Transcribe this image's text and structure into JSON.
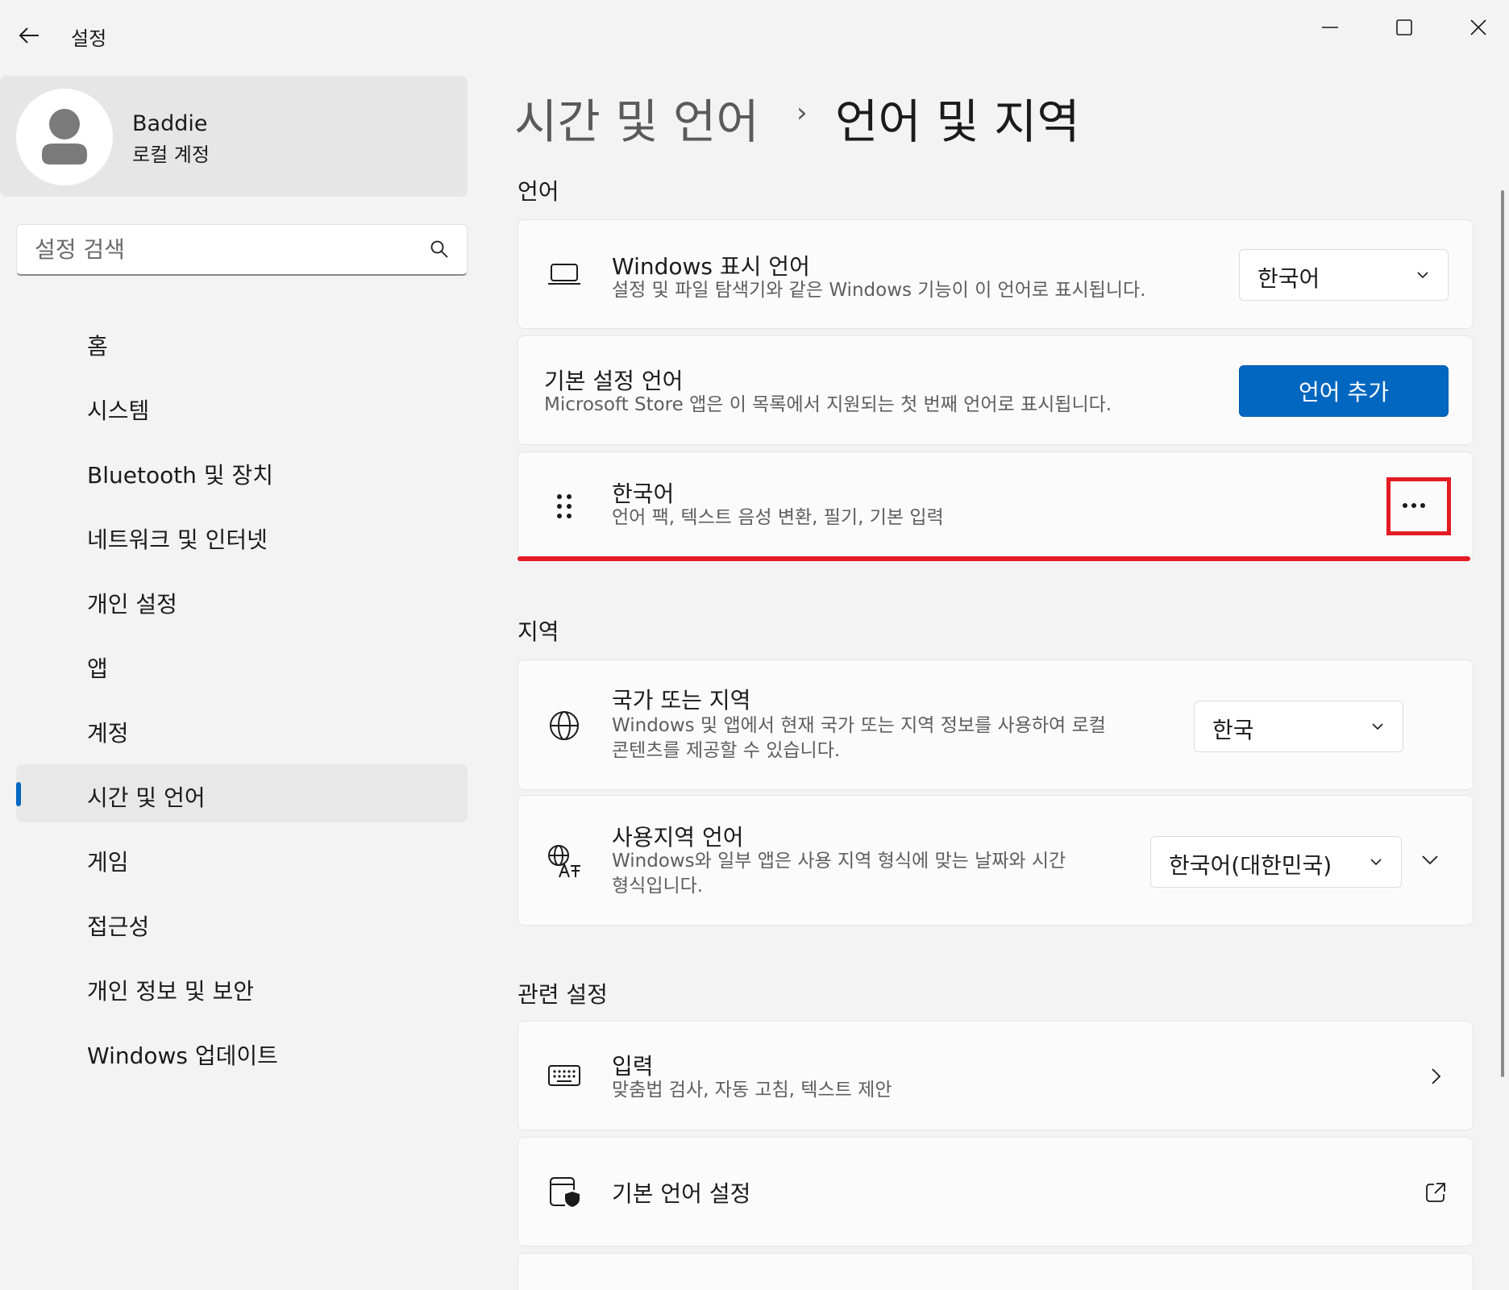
{
  "app": {
    "title": "설정"
  },
  "profile": {
    "name": "Baddie",
    "account_type": "로컬 계정"
  },
  "search": {
    "placeholder": "설정 검색"
  },
  "nav": {
    "items": [
      {
        "label": "홈"
      },
      {
        "label": "시스템"
      },
      {
        "label": "Bluetooth 및 장치"
      },
      {
        "label": "네트워크 및 인터넷"
      },
      {
        "label": "개인 설정"
      },
      {
        "label": "앱"
      },
      {
        "label": "계정"
      },
      {
        "label": "시간 및 언어",
        "selected": true
      },
      {
        "label": "게임"
      },
      {
        "label": "접근성"
      },
      {
        "label": "개인 정보 및 보안"
      },
      {
        "label": "Windows 업데이트"
      }
    ]
  },
  "breadcrumb": {
    "parent": "시간 및 언어",
    "separator": "›",
    "current": "언어 및 지역"
  },
  "language_section": {
    "header": "언어",
    "display_language": {
      "icon": "laptop-icon",
      "title": "Windows 표시 언어",
      "description": "설정 및 파일 탐색기와 같은 Windows 기능이 이 언어로 표시됩니다.",
      "value": "한국어"
    },
    "preferred_languages": {
      "title": "기본 설정 언어",
      "description": "Microsoft Store 앱은 이 목록에서 지원되는 첫 번째 언어로 표시됩니다.",
      "add_button": "언어 추가"
    },
    "installed_language": {
      "icon": "drag-handle-icon",
      "title": "한국어",
      "description": "언어 팩, 텍스트 음성 변환, 필기, 기본 입력",
      "more_icon": "more-options-icon"
    }
  },
  "region_section": {
    "header": "지역",
    "country": {
      "icon": "globe-icon",
      "title": "국가 또는 지역",
      "description_line1": "Windows 및 앱에서 현재 국가 또는 지역 정보를 사용하여 로컬",
      "description_line2": "콘텐츠를 제공할 수 있습니다.",
      "value": "한국"
    },
    "regional_format": {
      "icon": "regional-format-icon",
      "title": "사용지역 언어",
      "description_line1": "Windows와 일부 앱은 사용 지역 형식에 맞는 날짜와 시간",
      "description_line2": "형식입니다.",
      "value": "한국어(대한민국)"
    }
  },
  "related_section": {
    "header": "관련 설정",
    "typing": {
      "icon": "keyboard-icon",
      "title": "입력",
      "description": "맞춤법 검사, 자동 고침, 텍스트 제안"
    },
    "admin_language": {
      "icon": "admin-settings-icon",
      "title": "기본 언어 설정"
    }
  },
  "colors": {
    "accent": "#0067c0",
    "highlight": "#e31b23"
  }
}
